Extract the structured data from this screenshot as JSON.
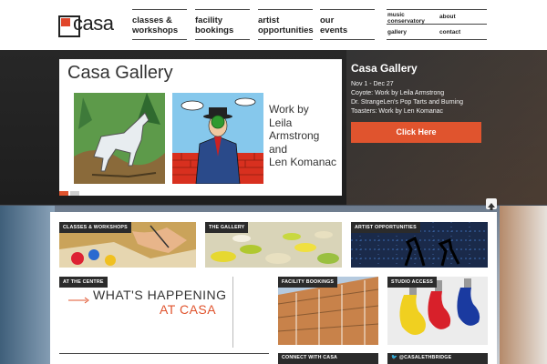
{
  "logo": {
    "text": "casa"
  },
  "nav": {
    "classes": [
      "classes &",
      "workshops"
    ],
    "facility": [
      "facility",
      "bookings"
    ],
    "artist": [
      "artist",
      "opportunities"
    ],
    "events": [
      "our",
      "events"
    ],
    "music": [
      "music",
      "conservatory"
    ],
    "about": "about",
    "gallery": "gallery",
    "contact": "contact"
  },
  "hero": {
    "card_title": "Casa Gallery",
    "card_work": [
      "Work by",
      "Leila",
      "Armstrong",
      "and",
      "Len Komanac"
    ],
    "info_title": "Casa Gallery",
    "info_lines": [
      "Nov 1 - Dec 27",
      "Coyote: Work by Leila Armstrong",
      "Dr. StrangeLen's Pop Tarts and Burning",
      "Toasters: Work by Len Komanac"
    ],
    "button": "Click Here"
  },
  "tiles": {
    "classes_workshops": "CLASSES & WORKSHOPS",
    "gallery": "THE GALLERY",
    "artist_opportunities": "ARTIST OPPORTUNITIES",
    "at_the_centre": "AT THE CENTRE",
    "facility_bookings": "FACILITY BOOKINGS",
    "studio_access": "STUDIO ACCESS",
    "connect": "CONNECT WITH CASA",
    "twitter": "@CASALETHBRIDGE"
  },
  "whats_happening": {
    "line1": "WHAT'S HAPPENING",
    "line2": "AT CASA"
  },
  "colors": {
    "accent": "#e0542e",
    "tag_bg": "#2b2b2b",
    "header_bg": "#ffffff"
  }
}
